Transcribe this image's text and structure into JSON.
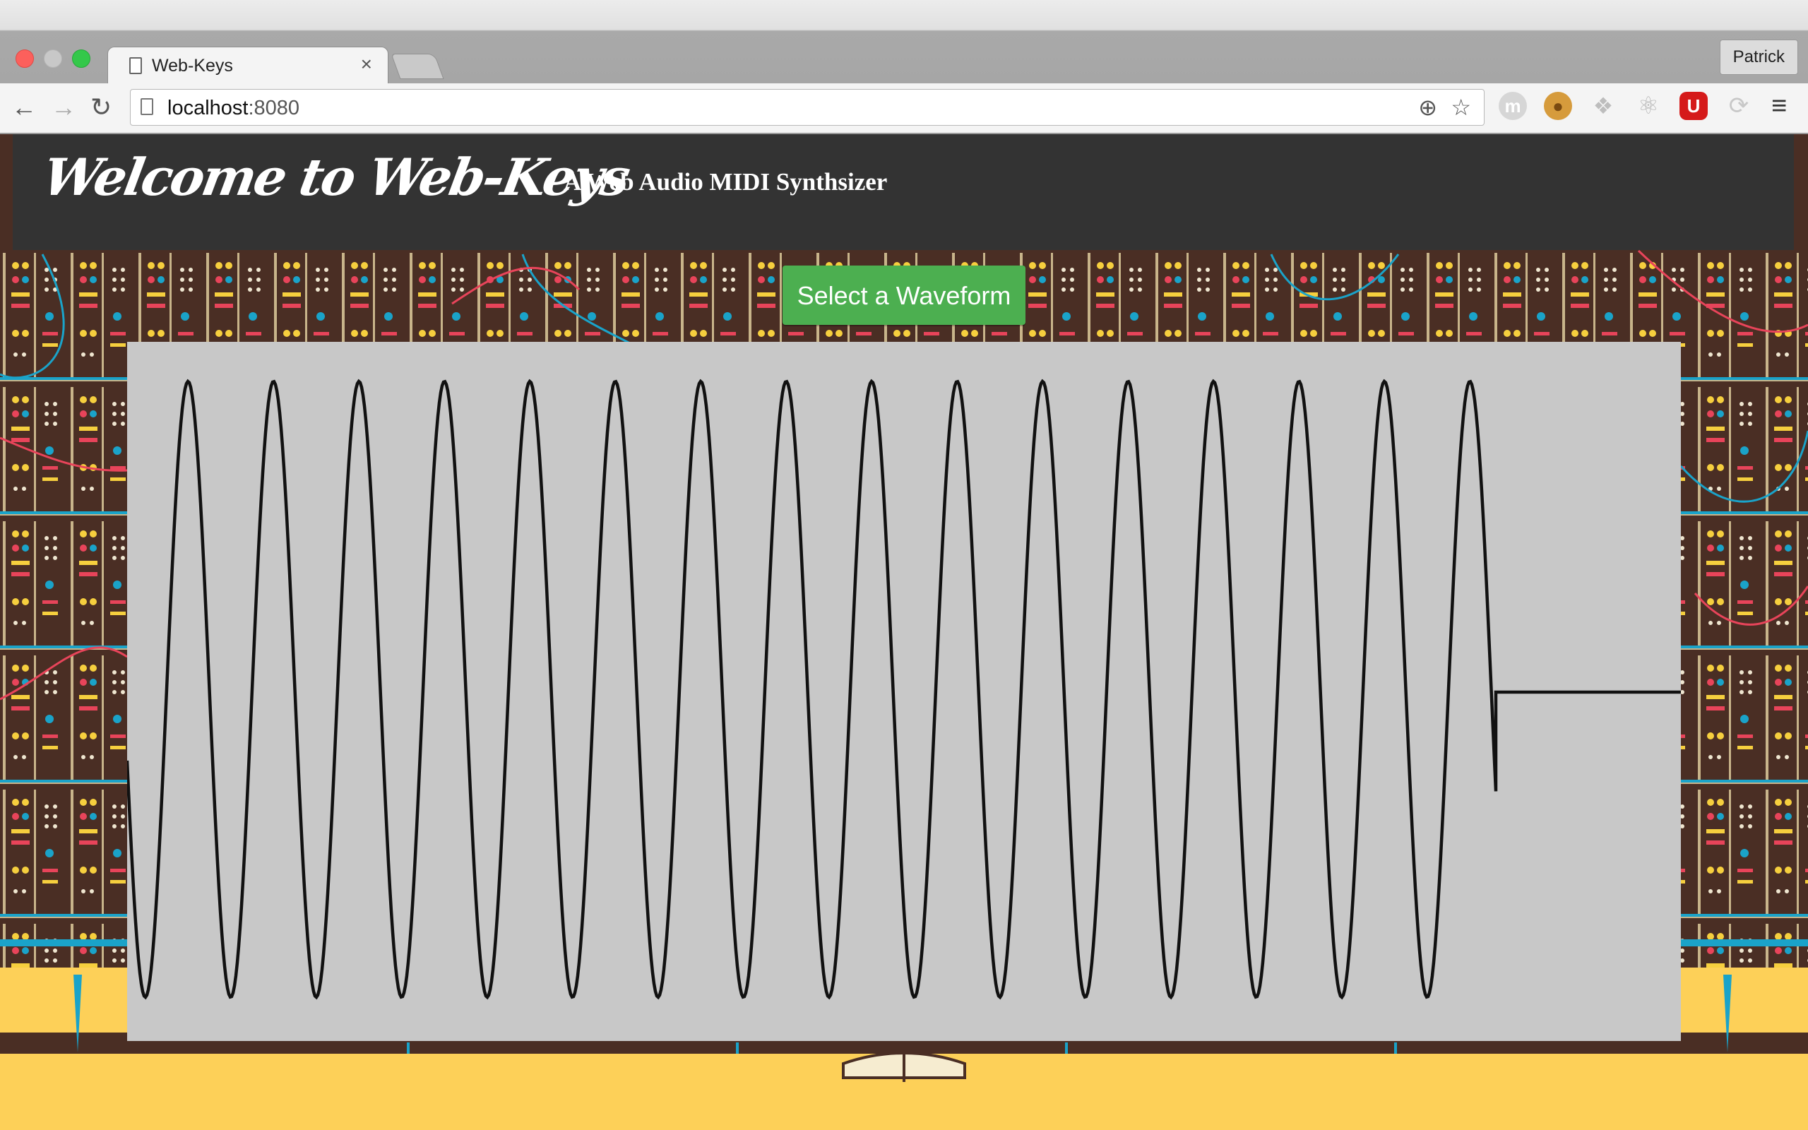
{
  "browser": {
    "tab_title": "Web-Keys",
    "tab_close": "×",
    "profile_name": "Patrick",
    "url_host": "localhost",
    "url_port": ":8080",
    "extensions": [
      "m",
      "cookie",
      "dropbox",
      "react-devtools",
      "ublock",
      "swirl"
    ]
  },
  "page": {
    "brand_title": "Welcome to Web-Keys",
    "subtitle": "A Web Audio MIDI Synthsizer",
    "waveform_button": "Select a Waveform",
    "waveform": "sine",
    "colors": {
      "header_bg": "#333333",
      "button_bg": "#4caf50",
      "scope_bg": "#c8c8c8",
      "trace": "#111111",
      "floor": "#fdd058",
      "panel_bg": "#4a2e24"
    }
  }
}
